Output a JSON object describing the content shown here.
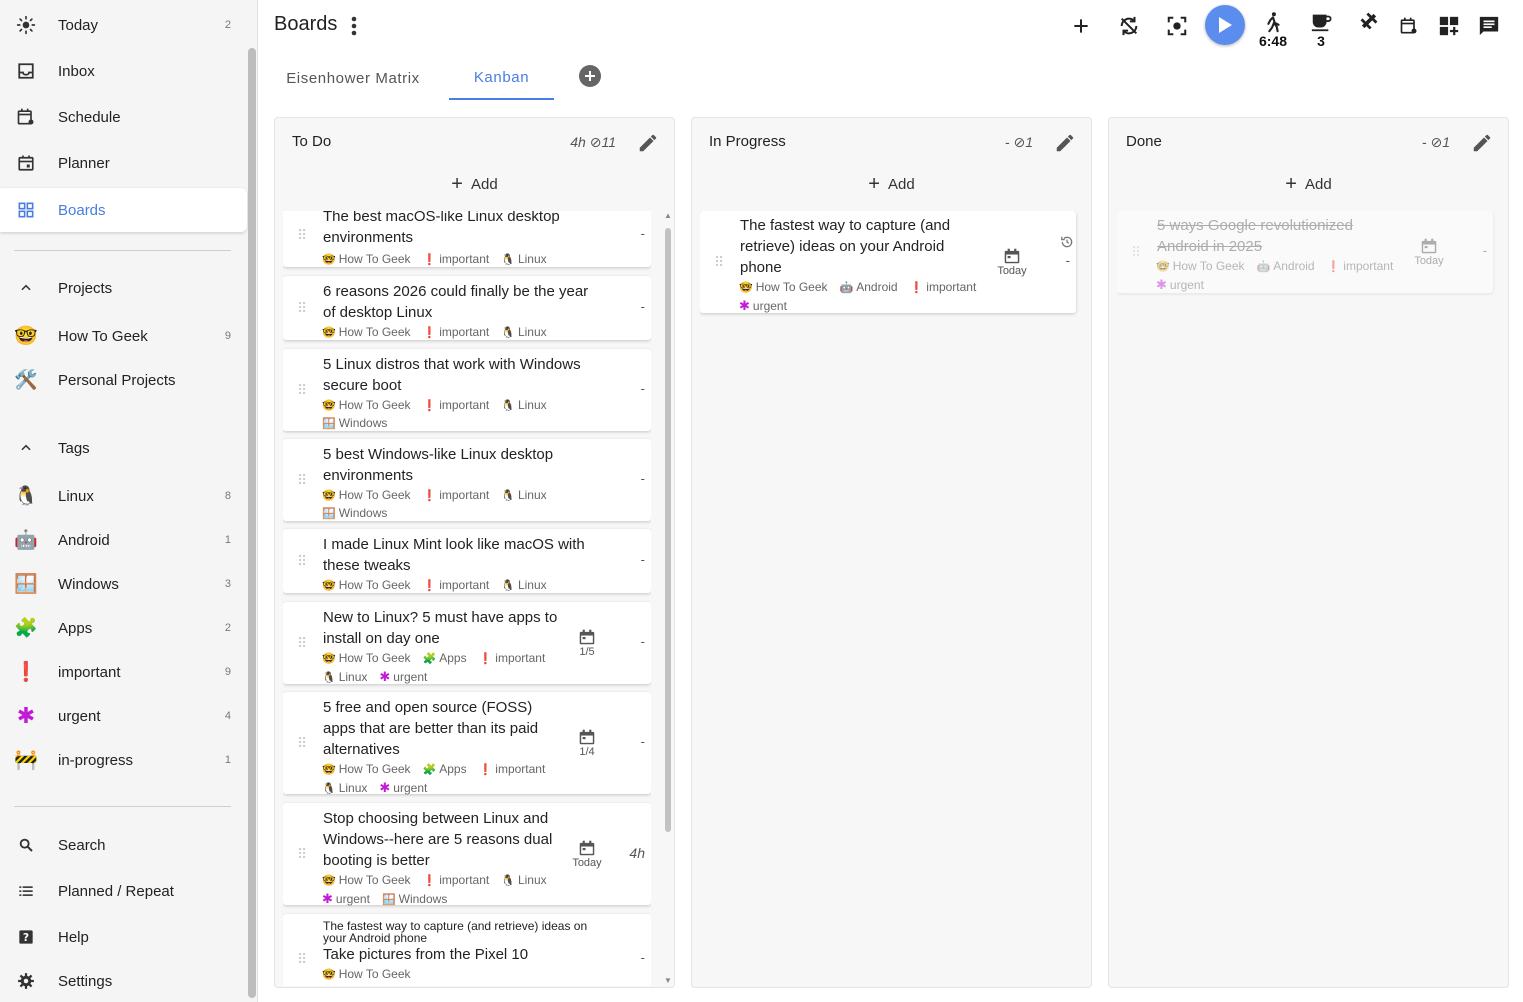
{
  "sidebar": {
    "main": [
      {
        "label": "Today",
        "count": "2",
        "icon": "sun-icon"
      },
      {
        "label": "Inbox",
        "icon": "inbox-icon"
      },
      {
        "label": "Schedule",
        "icon": "schedule-icon"
      },
      {
        "label": "Planner",
        "icon": "planner-icon"
      },
      {
        "label": "Boards",
        "icon": "grid-icon",
        "active": true
      }
    ],
    "projects_label": "Projects",
    "projects": [
      {
        "label": "How To Geek",
        "count": "9",
        "emoji": "🤓"
      },
      {
        "label": "Personal Projects",
        "count": "",
        "emoji": "🛠️"
      }
    ],
    "tags_label": "Tags",
    "tags": [
      {
        "label": "Linux",
        "count": "8",
        "emoji": "🐧"
      },
      {
        "label": "Android",
        "count": "1",
        "emoji": "🤖"
      },
      {
        "label": "Windows",
        "count": "3",
        "emoji": "🪟"
      },
      {
        "label": "Apps",
        "count": "2",
        "emoji": "🧩"
      },
      {
        "label": "important",
        "count": "9",
        "emoji": "❗"
      },
      {
        "label": "urgent",
        "count": "4",
        "emoji": "✱"
      },
      {
        "label": "in-progress",
        "count": "1",
        "emoji": "🚧"
      }
    ],
    "bottom": [
      {
        "label": "Search",
        "icon": "search-icon"
      },
      {
        "label": "Planned / Repeat",
        "icon": "list-icon"
      },
      {
        "label": "Help",
        "icon": "help-icon"
      },
      {
        "label": "Settings",
        "icon": "gear-icon"
      }
    ]
  },
  "header": {
    "title": "Boards",
    "walk_timer": "6:48",
    "coffee_count": "3",
    "accent": "#5b8def"
  },
  "tabs": [
    {
      "label": "Eisenhower Matrix"
    },
    {
      "label": "Kanban",
      "active": true
    }
  ],
  "columns": {
    "todo": {
      "title": "To Do",
      "stat": "4h ⊘11",
      "add": "Add"
    },
    "progress": {
      "title": "In Progress",
      "stat": "- ⊘1",
      "add": "Add"
    },
    "done": {
      "title": "Done",
      "stat": "- ⊘1",
      "add": "Add"
    }
  },
  "todo_tasks": [
    {
      "lines": [
        "The best macOS-like Linux desktop",
        "environments"
      ],
      "tags": [
        "🤓 How To Geek",
        "❗ important",
        "🐧 Linux"
      ],
      "right": "-"
    },
    {
      "lines": [
        "6 reasons 2026 could finally be the year",
        "of desktop Linux"
      ],
      "tags": [
        "🤓 How To Geek",
        "❗ important",
        "🐧 Linux"
      ],
      "right": "-"
    },
    {
      "lines": [
        "5 Linux distros that work with Windows",
        "secure boot"
      ],
      "tags": [
        "🤓 How To Geek",
        "❗ important",
        "🐧 Linux"
      ],
      "tags2": [
        "🪟 Windows"
      ],
      "right": "-"
    },
    {
      "lines": [
        "5 best Windows-like Linux desktop",
        "environments"
      ],
      "tags": [
        "🤓 How To Geek",
        "❗ important",
        "🐧 Linux"
      ],
      "tags2": [
        "🪟 Windows"
      ],
      "right": "-"
    },
    {
      "lines": [
        "I made Linux Mint look like macOS with",
        "these tweaks"
      ],
      "tags": [
        "🤓 How To Geek",
        "❗ important",
        "🐧 Linux"
      ],
      "right": "-"
    },
    {
      "lines": [
        "New to Linux? 5 must have apps to",
        "install on day one"
      ],
      "tags": [
        "🤓 How To Geek",
        "🧩 Apps",
        "❗ important"
      ],
      "tags2": [
        "🐧 Linux",
        "✱ urgent"
      ],
      "sched": "1/5",
      "right": "-"
    },
    {
      "lines": [
        "5 free and open source (FOSS)",
        "apps that are better than its paid",
        "alternatives"
      ],
      "tags": [
        "🤓 How To Geek",
        "🧩 Apps",
        "❗ important"
      ],
      "tags2": [
        "🐧 Linux",
        "✱ urgent"
      ],
      "sched": "1/4",
      "right": "-"
    },
    {
      "lines": [
        "Stop choosing between Linux and",
        "Windows--here are 5 reasons dual",
        "booting is better"
      ],
      "tags": [
        "🤓 How To Geek",
        "❗ important",
        "🐧 Linux"
      ],
      "tags2": [
        "✱ urgent",
        "🪟 Windows"
      ],
      "sched": "Today",
      "right": "4h"
    },
    {
      "parent": [
        "The fastest way to capture (and retrieve) ideas on",
        "your Android phone"
      ],
      "lines": [
        "Take pictures from the Pixel 10"
      ],
      "tags": [
        "🤓 How To Geek"
      ],
      "right": "-"
    }
  ],
  "progress_tasks": [
    {
      "lines": [
        "The fastest way to capture (and",
        "retrieve) ideas on your Android",
        "phone"
      ],
      "tags": [
        "🤓 How To Geek",
        "🤖 Android",
        "❗ important"
      ],
      "tags2": [
        "✱ urgent"
      ],
      "sched": "Today",
      "right": "-"
    }
  ],
  "done_tasks": [
    {
      "lines": [
        "5 ways Google revolutionized",
        "Android in 2025"
      ],
      "tags": [
        "🤓 How To Geek",
        "🤖 Android",
        "❗ important"
      ],
      "tags2": [
        "✱ urgent"
      ],
      "sched": "Today",
      "right": "-"
    }
  ]
}
